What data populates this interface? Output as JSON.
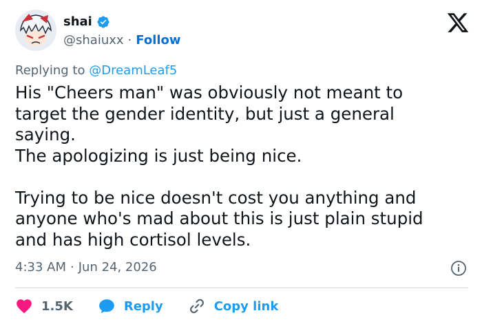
{
  "author": {
    "name": "shai",
    "handle": "@shaiuxx",
    "separator": "·",
    "follow_label": "Follow"
  },
  "reply": {
    "prefix": "Replying to",
    "mention": "@DreamLeaf5"
  },
  "tweet": {
    "lines": [
      "His \"Cheers man\" was obviously not meant to",
      "target the gender identity, but just a general",
      "saying.",
      "The apologizing is just being nice.",
      "Trying to be nice doesn't cost you anything and",
      "anyone who's mad about this is just plain stupid",
      "and has high cortisol levels."
    ]
  },
  "meta": {
    "time": "4:33 AM",
    "separator": "·",
    "date": "Jun 24, 2026"
  },
  "actions": {
    "like_count": "1.5K",
    "reply_label": "Reply",
    "copy_label": "Copy link"
  },
  "colors": {
    "link_blue": "#1d9bf0",
    "follow_blue": "#006fd6",
    "heart_pink": "#f91880",
    "text": "#0f1419",
    "muted": "#536471"
  },
  "icons": {
    "verified": "verified-badge-icon",
    "logo": "x-logo-icon",
    "info": "info-icon",
    "like": "heart-icon",
    "reply": "reply-bubble-icon",
    "copy": "link-icon"
  }
}
